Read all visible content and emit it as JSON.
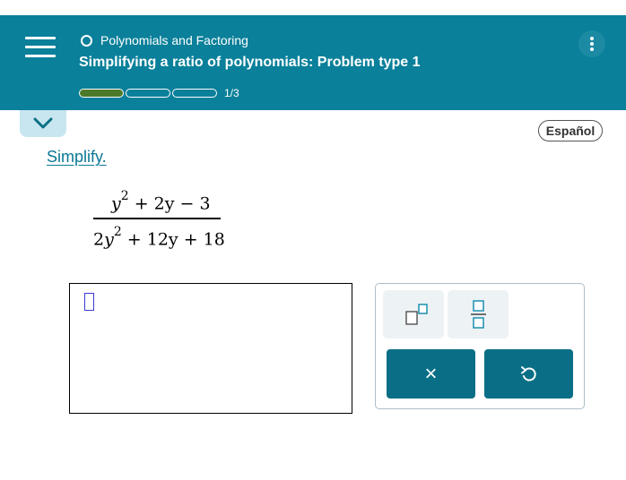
{
  "header": {
    "topic": "Polynomials and Factoring",
    "problem_title": "Simplifying a ratio of polynomials: Problem type 1",
    "progress": {
      "current": 1,
      "total": 3,
      "text": "1/3"
    },
    "colors": {
      "bar": "#0a809a",
      "progress_fill": "#4d7a2a"
    },
    "icons": {
      "menu": "hamburger-menu-icon",
      "topic": "circle-icon",
      "more": "kebab-icon"
    }
  },
  "collapse": {
    "icon": "chevron-down-icon"
  },
  "language_button": "Español",
  "instruction": "Simplify.",
  "expression": {
    "numerator": {
      "t1_var": "y",
      "t1_exp": "2",
      "rest": "+ 2y − 3"
    },
    "denominator": {
      "t1_coef": "2",
      "t1_var": "y",
      "t1_exp": "2",
      "rest": "+ 12y + 18"
    }
  },
  "keypad": {
    "keys": [
      {
        "name": "exponent",
        "icon": "exponent-template-icon"
      },
      {
        "name": "fraction",
        "icon": "fraction-template-icon"
      },
      {
        "name": "clear",
        "label": "×"
      },
      {
        "name": "undo",
        "icon": "undo-icon"
      }
    ]
  }
}
